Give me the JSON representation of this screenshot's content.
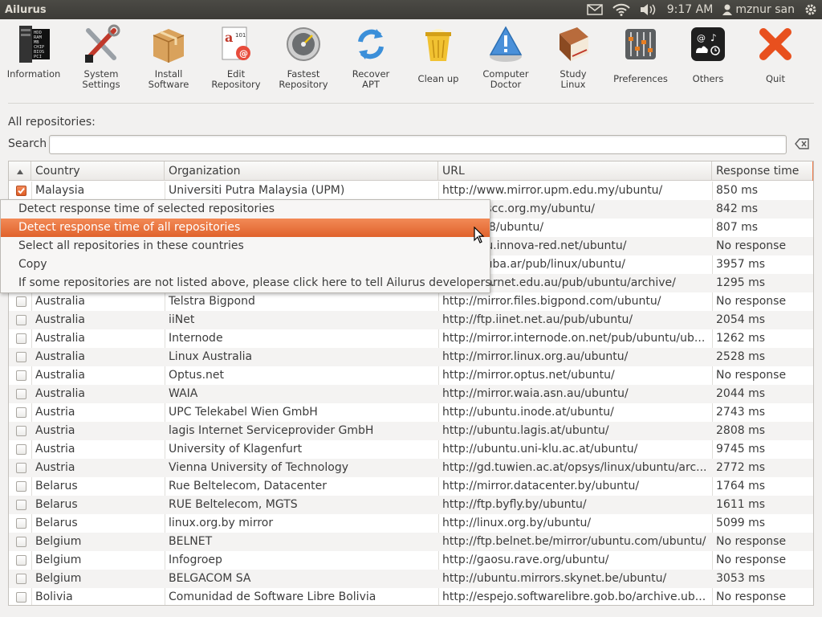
{
  "panel": {
    "app_title": "Ailurus",
    "time": "9:17 AM",
    "user": "mznur san",
    "icons": [
      "mail-icon",
      "wifi-icon",
      "volume-icon",
      "user-icon",
      "gear-icon"
    ]
  },
  "toolbar": [
    {
      "label": "Information",
      "icon": "information-icon"
    },
    {
      "label": "System\nSettings",
      "icon": "system-settings-icon"
    },
    {
      "label": "Install\nSoftware",
      "icon": "install-software-icon"
    },
    {
      "label": "Edit\nRepository",
      "icon": "edit-repository-icon"
    },
    {
      "label": "Fastest\nRepository",
      "icon": "fastest-repository-icon"
    },
    {
      "label": "Recover\nAPT",
      "icon": "recover-apt-icon"
    },
    {
      "label": "Clean up",
      "icon": "clean-up-icon"
    },
    {
      "label": "Computer\nDoctor",
      "icon": "computer-doctor-icon"
    },
    {
      "label": "Study\nLinux",
      "icon": "study-linux-icon"
    },
    {
      "label": "Preferences",
      "icon": "preferences-icon"
    },
    {
      "label": "Others",
      "icon": "others-icon"
    },
    {
      "label": "Quit",
      "icon": "quit-icon"
    }
  ],
  "main": {
    "heading": "All repositories:",
    "search_label": "Search",
    "search_value": ""
  },
  "table": {
    "columns": [
      "Country",
      "Organization",
      "URL",
      "Response time"
    ],
    "rows": [
      {
        "checked": true,
        "country": "Malaysia",
        "org": "Universiti Putra Malaysia (UPM)",
        "url": "http://www.mirror.upm.edu.my/ubuntu/",
        "time": "850 ms"
      },
      {
        "checked": false,
        "country": "",
        "org": "",
        "url": "...irror.oscc.org.my/ubuntu/",
        "time": "842 ms"
      },
      {
        "checked": false,
        "country": "",
        "org": "",
        "url": "...73.4.58/ubuntu/",
        "time": "807 ms"
      },
      {
        "checked": false,
        "country": "",
        "org": "",
        "url": "...ubuntu.innova-red.net/ubuntu/",
        "time": "No response"
      },
      {
        "checked": false,
        "country": "",
        "org": "",
        "url": "...o.ccc.uba.ar/pub/linux/ubuntu/",
        "time": "3957 ms"
      },
      {
        "checked": false,
        "country": "",
        "org": "",
        "url": "...irror.aarnet.edu.au/pub/ubuntu/archive/",
        "time": "1295 ms"
      },
      {
        "checked": false,
        "country": "Australia",
        "org": "Telstra Bigpond",
        "url": "http://mirror.files.bigpond.com/ubuntu/",
        "time": "No response"
      },
      {
        "checked": false,
        "country": "Australia",
        "org": "iiNet",
        "url": "http://ftp.iinet.net.au/pub/ubuntu/",
        "time": "2054 ms"
      },
      {
        "checked": false,
        "country": "Australia",
        "org": "Internode",
        "url": "http://mirror.internode.on.net/pub/ubuntu/ub...",
        "time": "1262 ms"
      },
      {
        "checked": false,
        "country": "Australia",
        "org": "Linux Australia",
        "url": "http://mirror.linux.org.au/ubuntu/",
        "time": "2528 ms"
      },
      {
        "checked": false,
        "country": "Australia",
        "org": "Optus.net",
        "url": "http://mirror.optus.net/ubuntu/",
        "time": "No response"
      },
      {
        "checked": false,
        "country": "Australia",
        "org": "WAIA",
        "url": "http://mirror.waia.asn.au/ubuntu/",
        "time": "2044 ms"
      },
      {
        "checked": false,
        "country": "Austria",
        "org": "UPC Telekabel Wien GmbH",
        "url": "http://ubuntu.inode.at/ubuntu/",
        "time": "2743 ms"
      },
      {
        "checked": false,
        "country": "Austria",
        "org": "lagis Internet Serviceprovider GmbH",
        "url": "http://ubuntu.lagis.at/ubuntu/",
        "time": "2808 ms"
      },
      {
        "checked": false,
        "country": "Austria",
        "org": "University of Klagenfurt",
        "url": "http://ubuntu.uni-klu.ac.at/ubuntu/",
        "time": "9745 ms"
      },
      {
        "checked": false,
        "country": "Austria",
        "org": "Vienna University of Technology",
        "url": "http://gd.tuwien.ac.at/opsys/linux/ubuntu/arc...",
        "time": "2772 ms"
      },
      {
        "checked": false,
        "country": "Belarus",
        "org": "Rue Beltelecom, Datacenter",
        "url": "http://mirror.datacenter.by/ubuntu/",
        "time": "1764 ms"
      },
      {
        "checked": false,
        "country": "Belarus",
        "org": "RUE Beltelecom, MGTS",
        "url": "http://ftp.byfly.by/ubuntu/",
        "time": "1611 ms"
      },
      {
        "checked": false,
        "country": "Belarus",
        "org": "linux.org.by mirror",
        "url": "http://linux.org.by/ubuntu/",
        "time": "5099 ms"
      },
      {
        "checked": false,
        "country": "Belgium",
        "org": "BELNET",
        "url": "http://ftp.belnet.be/mirror/ubuntu.com/ubuntu/",
        "time": "No response"
      },
      {
        "checked": false,
        "country": "Belgium",
        "org": "Infogroep",
        "url": "http://gaosu.rave.org/ubuntu/",
        "time": "No response"
      },
      {
        "checked": false,
        "country": "Belgium",
        "org": "BELGACOM SA",
        "url": "http://ubuntu.mirrors.skynet.be/ubuntu/",
        "time": "3053 ms"
      },
      {
        "checked": false,
        "country": "Bolivia",
        "org": "Comunidad de Software Libre Bolivia",
        "url": "http://espejo.softwarelibre.gob.bo/archive.ub...",
        "time": "No response"
      }
    ]
  },
  "context_menu": {
    "items": [
      {
        "label": "Detect response time of selected repositories",
        "active": false
      },
      {
        "label": "Detect response time of all repositories",
        "active": true
      },
      {
        "label": "Select all repositories in these countries",
        "active": false
      },
      {
        "label": "Copy",
        "active": false
      },
      {
        "label": "If some repositories are not listed above, please click here to tell Ailurus developers.",
        "active": false
      }
    ]
  },
  "colors": {
    "accent": "#e9672f",
    "panel_bg": "#3c3b37",
    "window_bg": "#f2f1f0"
  }
}
